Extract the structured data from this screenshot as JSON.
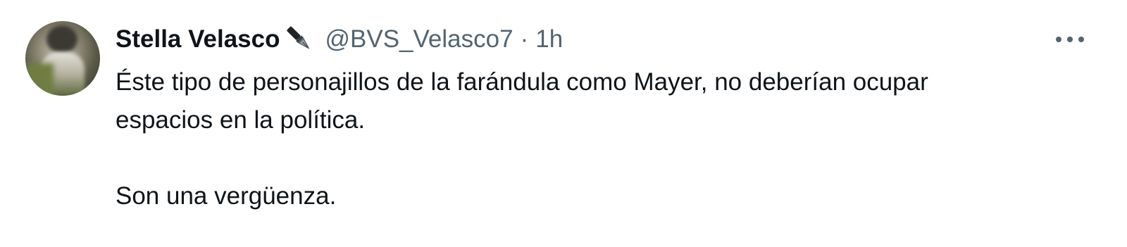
{
  "author": {
    "display_name": "Stella Velasco",
    "badge_icon": "fountain-pen-icon",
    "handle": "@BVS_Velasco7",
    "separator": "·",
    "time": "1h"
  },
  "tweet": {
    "line1": "Éste tipo de personajillos de la farándula como Mayer, no deberían ocupar",
    "line2": "espacios en la política.",
    "line3": "Son una vergüenza."
  },
  "actions": {
    "more_icon": "more-options-icon"
  },
  "colors": {
    "text_primary": "#0f1419",
    "text_secondary": "#536471",
    "background": "#ffffff"
  }
}
